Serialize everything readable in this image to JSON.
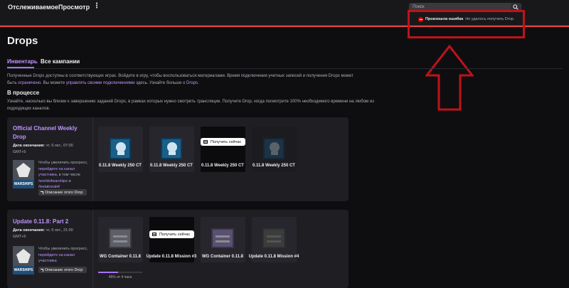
{
  "topbar": {
    "nav_following": "Отслеживаемое",
    "nav_browse": "Просмотр",
    "more_label": "⋮",
    "search_placeholder": "Поиск"
  },
  "toast": {
    "title": "Произошла ошибка",
    "message": "Не удалось получить Drop."
  },
  "page": {
    "title": "Drops",
    "tabs": [
      {
        "label": "Инвентарь",
        "active": true
      },
      {
        "label": "Все кампании",
        "active": false
      }
    ],
    "description": {
      "part1": "Полученные Drops доступны в соответствующих играх. Войдите в игру, чтобы воспользоваться материалами. Время подключения учетных записей и получения Drops может быть",
      "link1": "ограничено",
      "part2": ". Вы можете",
      "link2": "управлять своими подключениями",
      "part3": "здесь. Узнайте больше о",
      "link3": "Drops",
      "part4": "."
    },
    "in_progress": {
      "title": "В процессе",
      "description": "Узнайте, насколько вы близки к завершению заданий Drops, в рамках которых нужно смотреть трансляции. Получите Drop, когда посмотрите 100% необходимого времени на любом из подходящих каналов."
    }
  },
  "campaigns": [
    {
      "title": "Official Channel Weekly Drop",
      "end_label": "Дата окончания:",
      "end_value": "чт, 6 окт., 07:00 GMT+5",
      "game_logo_text": "WARSHIPS",
      "link_text_part1": "Чтобы увеличить прогресс,",
      "link_text_link1": "перейдите на канал участника",
      "link_text_part2": ", в том числе",
      "link_text_link2": "/worldofwarships",
      "link_text_part3": "и",
      "link_text_link3": "/lestakorab4",
      "description_button": "Описание этого Drop",
      "rewards": [
        {
          "label": "0.11.8 Weekly 250 CT",
          "icon": "skull-icon",
          "claim": false,
          "dim": false
        },
        {
          "label": "0.11.8 Weekly 250 CT",
          "icon": "skull-icon",
          "claim": false,
          "dim": false
        },
        {
          "label": "0.11.8 Weekly 250 CT",
          "icon": "none",
          "claim": true,
          "dim": false
        },
        {
          "label": "0.11.8 Weekly 250 CT",
          "icon": "skull-icon",
          "claim": false,
          "dim": true
        }
      ]
    },
    {
      "title": "Update 0.11.8: Part 2",
      "end_label": "Дата окончания:",
      "end_value": "чт, 6 окт., 21:00 GMT+5",
      "game_logo_text": "WARSHIPS",
      "link_text_part1": "Чтобы увеличить прогресс,",
      "link_text_link1": "перейдите на канал участника",
      "description_button": "Описание этого Drop",
      "rewards": [
        {
          "label": "WG Container 0.11.8",
          "icon": "crate-icon",
          "claim": false
        },
        {
          "label": "Update 0.11.8 Mission #3",
          "icon": "none",
          "claim": true
        },
        {
          "label": "WG Container 0.11.8",
          "icon": "crate-icon",
          "claim": false
        },
        {
          "label": "Update 0.11.8 Mission #4",
          "icon": "crate-icon",
          "claim": false
        }
      ],
      "progress": {
        "fraction": 0.45,
        "text": "45% от 4 часа"
      }
    }
  ],
  "claim_label": "Получить сейчас",
  "colors": {
    "accent": "#a970ff",
    "link": "#bf94ff",
    "error": "#eb0400",
    "annotation": "#c0121a"
  }
}
